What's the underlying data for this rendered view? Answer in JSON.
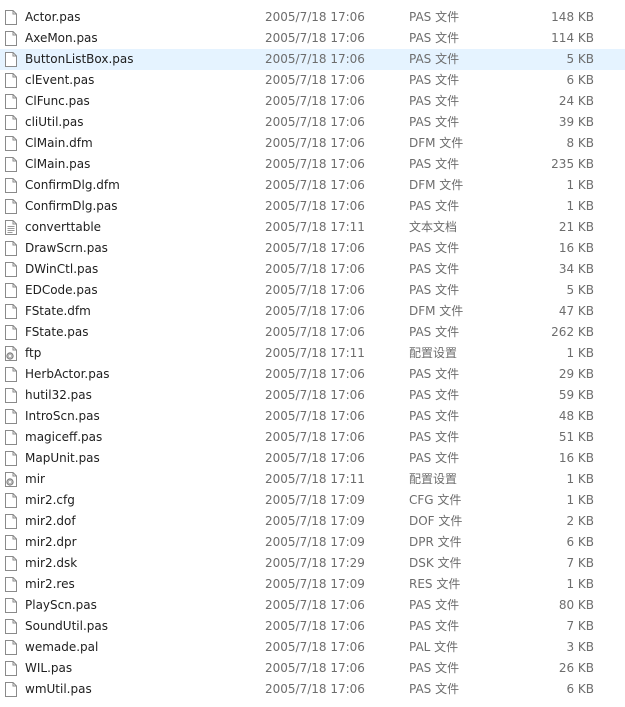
{
  "files": [
    {
      "name": "Actor.pas",
      "date": "2005/7/18 17:06",
      "type": "PAS 文件",
      "size": "148 KB",
      "icon": "file-icon"
    },
    {
      "name": "AxeMon.pas",
      "date": "2005/7/18 17:06",
      "type": "PAS 文件",
      "size": "114 KB",
      "icon": "file-icon"
    },
    {
      "name": "ButtonListBox.pas",
      "date": "2005/7/18 17:06",
      "type": "PAS 文件",
      "size": "5 KB",
      "icon": "file-icon",
      "selected": true
    },
    {
      "name": "clEvent.pas",
      "date": "2005/7/18 17:06",
      "type": "PAS 文件",
      "size": "6 KB",
      "icon": "file-icon"
    },
    {
      "name": "ClFunc.pas",
      "date": "2005/7/18 17:06",
      "type": "PAS 文件",
      "size": "24 KB",
      "icon": "file-icon"
    },
    {
      "name": "cliUtil.pas",
      "date": "2005/7/18 17:06",
      "type": "PAS 文件",
      "size": "39 KB",
      "icon": "file-icon"
    },
    {
      "name": "ClMain.dfm",
      "date": "2005/7/18 17:06",
      "type": "DFM 文件",
      "size": "8 KB",
      "icon": "file-icon"
    },
    {
      "name": "ClMain.pas",
      "date": "2005/7/18 17:06",
      "type": "PAS 文件",
      "size": "235 KB",
      "icon": "file-icon"
    },
    {
      "name": "ConfirmDlg.dfm",
      "date": "2005/7/18 17:06",
      "type": "DFM 文件",
      "size": "1 KB",
      "icon": "file-icon"
    },
    {
      "name": "ConfirmDlg.pas",
      "date": "2005/7/18 17:06",
      "type": "PAS 文件",
      "size": "1 KB",
      "icon": "file-icon"
    },
    {
      "name": "converttable",
      "date": "2005/7/18 17:11",
      "type": "文本文档",
      "size": "21 KB",
      "icon": "text-document-icon"
    },
    {
      "name": "DrawScrn.pas",
      "date": "2005/7/18 17:06",
      "type": "PAS 文件",
      "size": "16 KB",
      "icon": "file-icon"
    },
    {
      "name": "DWinCtl.pas",
      "date": "2005/7/18 17:06",
      "type": "PAS 文件",
      "size": "34 KB",
      "icon": "file-icon"
    },
    {
      "name": "EDCode.pas",
      "date": "2005/7/18 17:06",
      "type": "PAS 文件",
      "size": "5 KB",
      "icon": "file-icon"
    },
    {
      "name": "FState.dfm",
      "date": "2005/7/18 17:06",
      "type": "DFM 文件",
      "size": "47 KB",
      "icon": "file-icon"
    },
    {
      "name": "FState.pas",
      "date": "2005/7/18 17:06",
      "type": "PAS 文件",
      "size": "262 KB",
      "icon": "file-icon"
    },
    {
      "name": "ftp",
      "date": "2005/7/18 17:11",
      "type": "配置设置",
      "size": "1 KB",
      "icon": "settings-file-icon"
    },
    {
      "name": "HerbActor.pas",
      "date": "2005/7/18 17:06",
      "type": "PAS 文件",
      "size": "29 KB",
      "icon": "file-icon"
    },
    {
      "name": "hutil32.pas",
      "date": "2005/7/18 17:06",
      "type": "PAS 文件",
      "size": "59 KB",
      "icon": "file-icon"
    },
    {
      "name": "IntroScn.pas",
      "date": "2005/7/18 17:06",
      "type": "PAS 文件",
      "size": "48 KB",
      "icon": "file-icon"
    },
    {
      "name": "magiceff.pas",
      "date": "2005/7/18 17:06",
      "type": "PAS 文件",
      "size": "51 KB",
      "icon": "file-icon"
    },
    {
      "name": "MapUnit.pas",
      "date": "2005/7/18 17:06",
      "type": "PAS 文件",
      "size": "16 KB",
      "icon": "file-icon"
    },
    {
      "name": "mir",
      "date": "2005/7/18 17:11",
      "type": "配置设置",
      "size": "1 KB",
      "icon": "settings-file-icon"
    },
    {
      "name": "mir2.cfg",
      "date": "2005/7/18 17:09",
      "type": "CFG 文件",
      "size": "1 KB",
      "icon": "file-icon"
    },
    {
      "name": "mir2.dof",
      "date": "2005/7/18 17:09",
      "type": "DOF 文件",
      "size": "2 KB",
      "icon": "file-icon"
    },
    {
      "name": "mir2.dpr",
      "date": "2005/7/18 17:09",
      "type": "DPR 文件",
      "size": "6 KB",
      "icon": "file-icon"
    },
    {
      "name": "mir2.dsk",
      "date": "2005/7/18 17:29",
      "type": "DSK 文件",
      "size": "7 KB",
      "icon": "file-icon"
    },
    {
      "name": "mir2.res",
      "date": "2005/7/18 17:09",
      "type": "RES 文件",
      "size": "1 KB",
      "icon": "file-icon"
    },
    {
      "name": "PlayScn.pas",
      "date": "2005/7/18 17:06",
      "type": "PAS 文件",
      "size": "80 KB",
      "icon": "file-icon"
    },
    {
      "name": "SoundUtil.pas",
      "date": "2005/7/18 17:06",
      "type": "PAS 文件",
      "size": "7 KB",
      "icon": "file-icon"
    },
    {
      "name": "wemade.pal",
      "date": "2005/7/18 17:06",
      "type": "PAL 文件",
      "size": "3 KB",
      "icon": "file-icon"
    },
    {
      "name": "WIL.pas",
      "date": "2005/7/18 17:06",
      "type": "PAS 文件",
      "size": "26 KB",
      "icon": "file-icon"
    },
    {
      "name": "wmUtil.pas",
      "date": "2005/7/18 17:06",
      "type": "PAS 文件",
      "size": "6 KB",
      "icon": "file-icon"
    }
  ],
  "colors": {
    "selected_row": "#e5f3ff",
    "name_text": "#1e1e1e",
    "detail_text": "#6d6d6d"
  }
}
